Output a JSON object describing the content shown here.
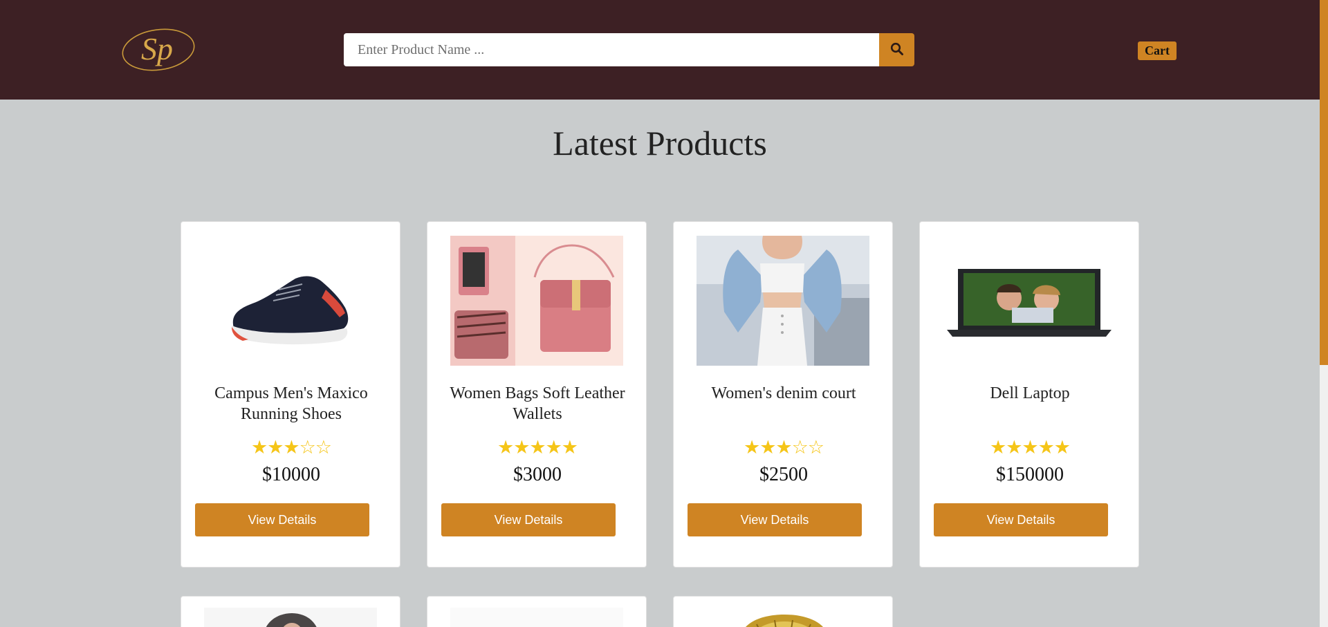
{
  "header": {
    "logo_text": "Sp",
    "search": {
      "placeholder": "Enter Product Name ...",
      "value": "",
      "icon": "search-icon"
    },
    "cart_label": "Cart"
  },
  "main": {
    "title": "Latest Products",
    "products": [
      {
        "name": "Campus Men's Maxico Running Shoes",
        "rating": 3,
        "stars": "★★★☆☆",
        "price": "$10000",
        "button": "View Details",
        "image": "running-shoe-image"
      },
      {
        "name": "Women Bags Soft Leather Wallets",
        "rating": 5,
        "stars": "★★★★★",
        "price": "$3000",
        "button": "View Details",
        "image": "pink-leather-wallet-image"
      },
      {
        "name": "Women's denim court",
        "rating": 3,
        "stars": "★★★☆☆",
        "price": "$2500",
        "button": "View Details",
        "image": "denim-jacket-image"
      },
      {
        "name": "Dell Laptop",
        "rating": 5,
        "stars": "★★★★★",
        "price": "$150000",
        "button": "View Details",
        "image": "laptop-image"
      }
    ]
  },
  "colors": {
    "header_bg": "#3d2024",
    "accent": "#cf8423",
    "page_bg": "#c9cccd",
    "star": "#f5c518"
  }
}
